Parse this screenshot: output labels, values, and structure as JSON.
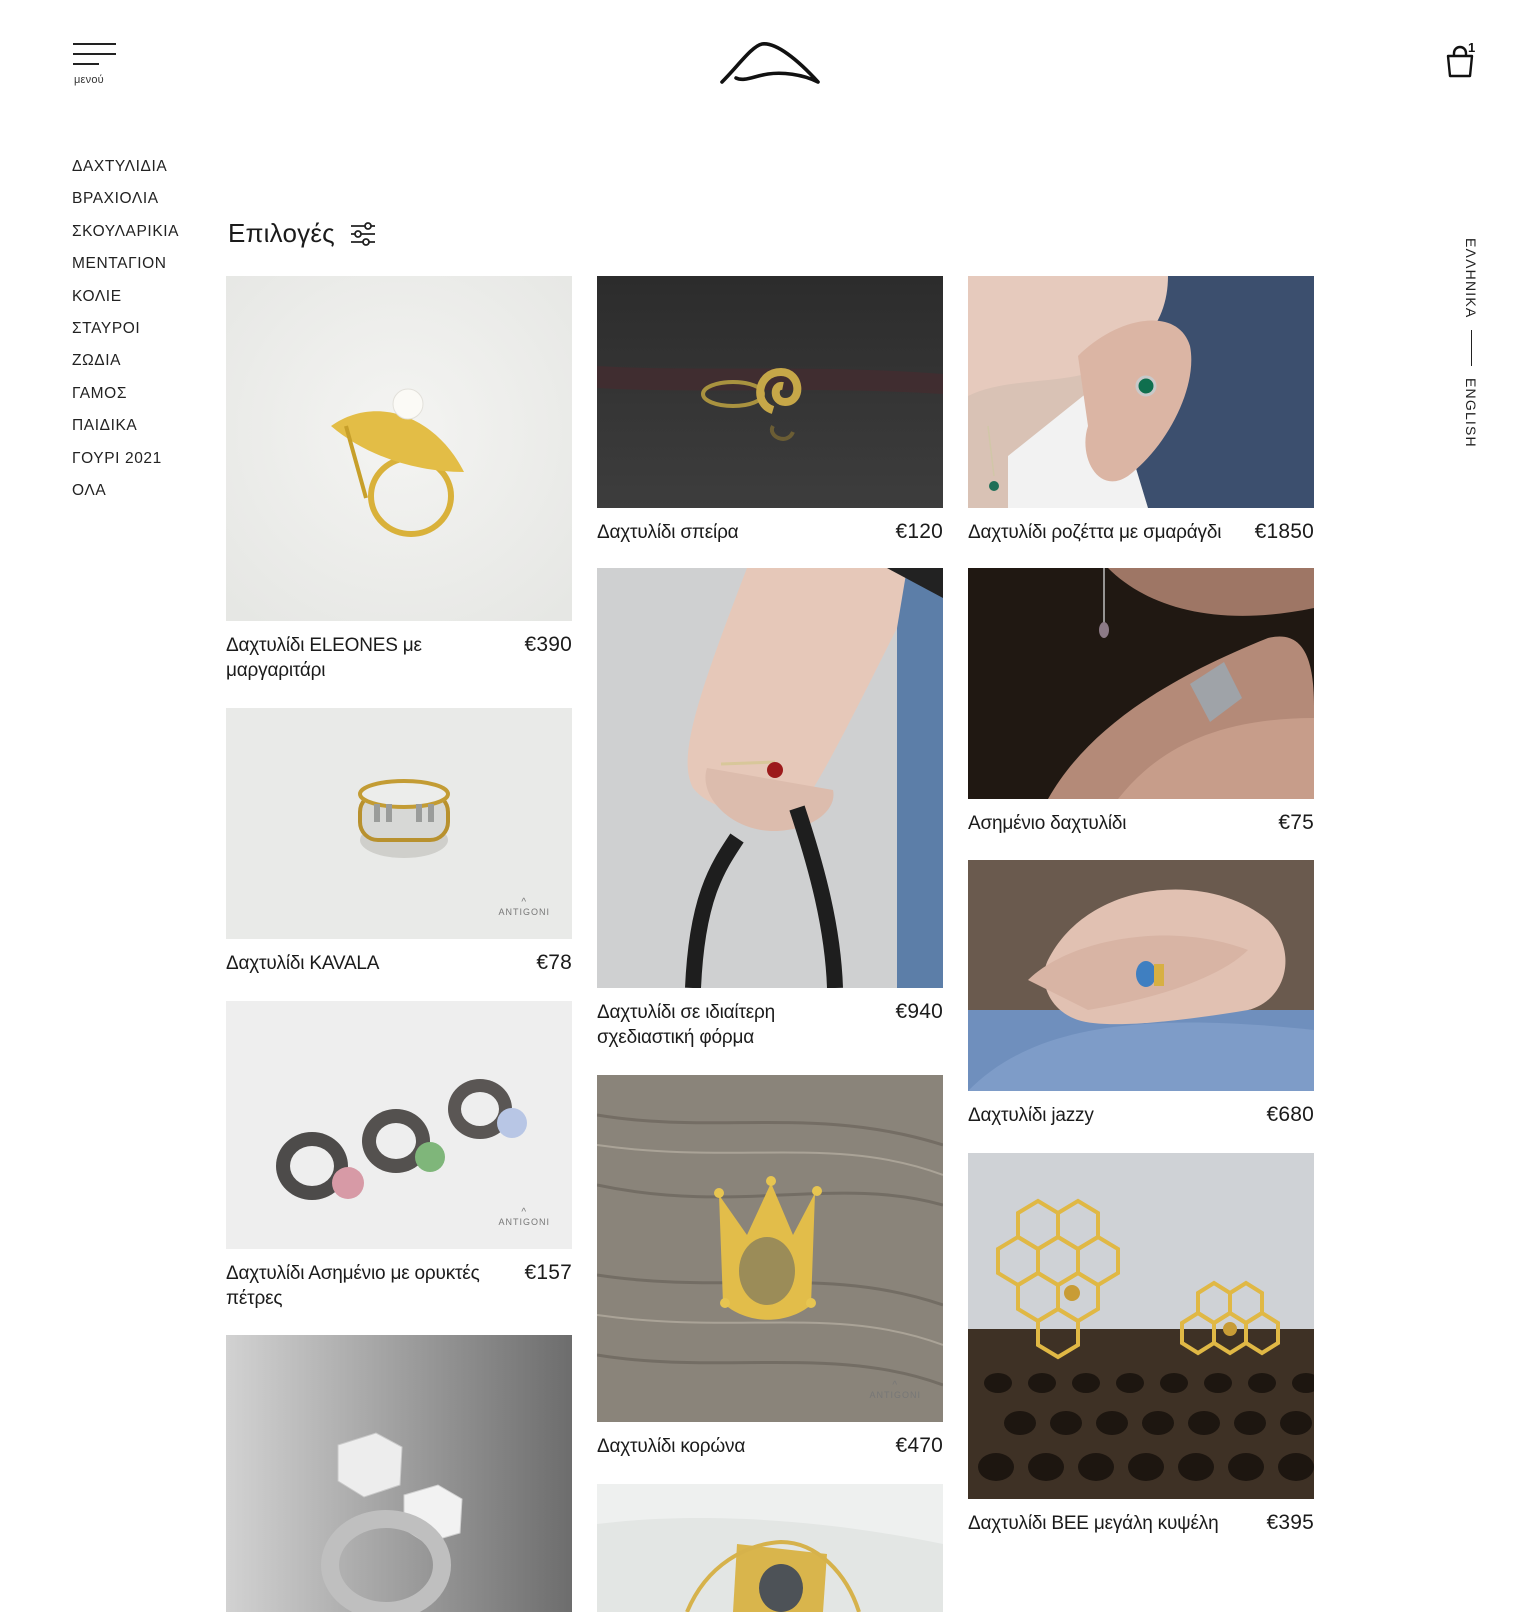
{
  "header": {
    "menu_label": "μενού",
    "cart_count": "1"
  },
  "categories": [
    "ΔΑΧΤΥΛΙΔΙΑ",
    "ΒΡΑΧΙΟΛΙΑ",
    "ΣΚΟΥΛΑΡΙΚΙΑ",
    "ΜΕΝΤΑΓΙΟΝ",
    "ΚΟΛΙΕ",
    "ΣΤΑΥΡΟΙ",
    "ΖΩΔΙΑ",
    "ΓΑΜΟΣ",
    "ΠΑΙΔΙΚΑ",
    "ΓΟΥΡΙ 2021",
    "ΟΛΑ"
  ],
  "filter": {
    "label": "Επιλογές"
  },
  "language": {
    "current": "ΕΛΛΗΝΙΚΑ",
    "other": "ENGLISH"
  },
  "brand_watermark": "ANTIGONI",
  "products": [
    {
      "title": "Δαχτυλίδι ELEONES με μαργαριτάρι",
      "price": "€390"
    },
    {
      "title": "Δαχτυλίδι KAVALA",
      "price": "€78"
    },
    {
      "title": "Δαχτυλίδι Ασημένιο με ορυκτές πέτρες",
      "price": "€157"
    },
    {
      "title": "Δαχτυλίδι σπείρα",
      "price": "€120"
    },
    {
      "title": "Δαχτυλίδι σε ιδιαίτερη σχεδιαστική φόρμα",
      "price": "€940"
    },
    {
      "title": "Δαχτυλίδι κορώνα",
      "price": "€470"
    },
    {
      "title": "Δαχτυλίδι ροζέττα με σμαράγδι",
      "price": "€1850"
    },
    {
      "title": "Ασημένιο δαχτυλίδι",
      "price": "€75"
    },
    {
      "title": "Δαχτυλίδι jazzy",
      "price": "€680"
    },
    {
      "title": "Δαχτυλίδι BEE μεγάλη κυψέλη",
      "price": "€395"
    }
  ]
}
